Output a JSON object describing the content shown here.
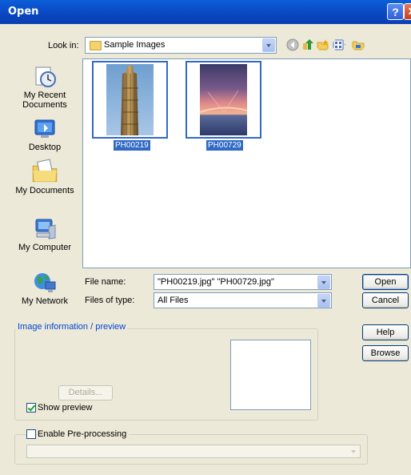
{
  "window": {
    "title": "Open",
    "help_glyph": "?",
    "close_glyph": "✕"
  },
  "lookin": {
    "label": "Look in:",
    "value": "Sample Images"
  },
  "toolbar": {
    "icons": [
      "back-icon",
      "up-folder-icon",
      "new-folder-icon",
      "views-menu-icon",
      "tools-folder-icon"
    ]
  },
  "places": [
    {
      "label": "My Recent Documents",
      "icon": "recent-documents-icon"
    },
    {
      "label": "Desktop",
      "icon": "desktop-icon"
    },
    {
      "label": "My Documents",
      "icon": "my-documents-icon"
    },
    {
      "label": "My Computer",
      "icon": "my-computer-icon"
    },
    {
      "label": "My Network",
      "icon": "my-network-icon"
    }
  ],
  "files": [
    {
      "name": "PH00219",
      "selected": true
    },
    {
      "name": "PH00729",
      "selected": true
    }
  ],
  "filename": {
    "label": "File name:",
    "value": "\"PH00219.jpg\" \"PH00729.jpg\""
  },
  "filetype": {
    "label": "Files of type:",
    "value": "All Files"
  },
  "buttons": {
    "open": "Open",
    "cancel": "Cancel",
    "help": "Help",
    "browse": "Browse"
  },
  "preview": {
    "title": "Image information / preview",
    "details": "Details...",
    "show_preview": "Show preview",
    "show_preview_checked": true
  },
  "preprocess": {
    "label": "Enable Pre-processing",
    "checked": false,
    "value": ""
  },
  "colors": {
    "titlebar": "#0a46c0",
    "selection": "#316ac5",
    "group_title": "#0046d5"
  }
}
